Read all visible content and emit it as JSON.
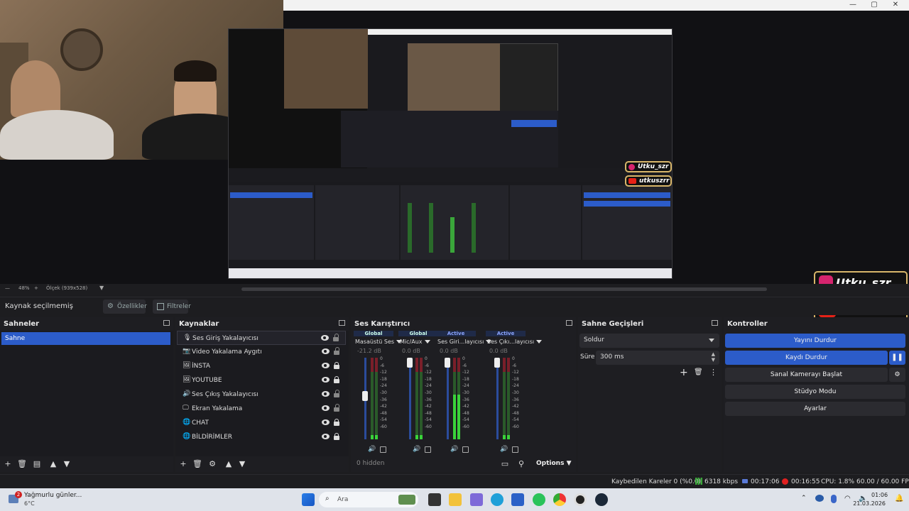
{
  "window": {
    "minimize": "—",
    "maximize": "▢",
    "close": "✕"
  },
  "zoom": {
    "percent": "48%",
    "scale": "Ölçek (939x528)"
  },
  "source_toolbar": {
    "no_source": "Kaynak seçilmemiş",
    "properties": "Özellikler",
    "filters": "Filtreler"
  },
  "scenes": {
    "title": "Sahneler",
    "items": [
      {
        "label": "Sahne",
        "selected": true
      }
    ]
  },
  "sources": {
    "title": "Kaynaklar",
    "items": [
      {
        "label": "Ses Giriş Yakalayıcısı",
        "icon": "microphone-icon",
        "glyph": "🎙",
        "locked": false,
        "selected": true
      },
      {
        "label": "Video Yakalama Aygıtı",
        "icon": "camera-icon",
        "glyph": "📷",
        "locked": false,
        "selected": false
      },
      {
        "label": "İNSTA",
        "icon": "image-icon",
        "glyph": "🖼",
        "locked": true,
        "selected": false
      },
      {
        "label": "YOUTUBE",
        "icon": "image-icon",
        "glyph": "🖼",
        "locked": true,
        "selected": false
      },
      {
        "label": "Ses Çıkış Yakalayıcısı",
        "icon": "speaker-icon",
        "glyph": "🔊",
        "locked": false,
        "selected": false
      },
      {
        "label": "Ekran Yakalama",
        "icon": "monitor-icon",
        "glyph": "🖵",
        "locked": false,
        "selected": false
      },
      {
        "label": "CHAT",
        "icon": "browser-icon",
        "glyph": "🌐",
        "locked": true,
        "selected": false
      },
      {
        "label": "BİLDİRİMLER",
        "icon": "browser-icon",
        "glyph": "🌐",
        "locked": true,
        "selected": false
      }
    ]
  },
  "mixer": {
    "title": "Ses Karıştırıcı",
    "hidden_label": "0 hidden",
    "options_label": "Options",
    "ticks": [
      "0",
      "-6",
      "-12",
      "-18",
      "-24",
      "-30",
      "-36",
      "-42",
      "-48",
      "-54",
      "-60"
    ],
    "channels": [
      {
        "tag": "Global",
        "name": "Masaüstü Ses",
        "db": "-21.2 dB",
        "level": 0.55,
        "meter_level": 0.05
      },
      {
        "tag": "Global",
        "name": "Mic/Aux",
        "db": "0.0 dB",
        "level": 1.0,
        "meter_level": 0.05
      },
      {
        "tag": "Active",
        "name": "Ses Giri...layıcısı",
        "db": "0.0 dB",
        "level": 1.0,
        "meter_level": 0.55
      },
      {
        "tag": "Active",
        "name": "Ses Çıkı...layıcısı",
        "db": "0.0 dB",
        "level": 1.0,
        "meter_level": 0.05
      }
    ]
  },
  "transitions": {
    "title": "Sahne Geçişleri",
    "selected": "Soldur",
    "duration_label": "Süre",
    "duration_value": "300 ms"
  },
  "controls": {
    "title": "Kontroller",
    "stop_stream": "Yayını Durdur",
    "stop_recording": "Kaydı Durdur",
    "virtual_cam": "Sanal Kamerayı Başlat",
    "studio_mode": "Stüdyo Modu",
    "settings": "Ayarlar"
  },
  "status": {
    "dropped": "Kaybedilen Kareler 0 (%0.0)",
    "bitrate": "6318 kbps",
    "stream_time": "00:17:06",
    "rec_time": "00:16:55",
    "cpu": "CPU: 1.8%",
    "fps": "60.00 / 60.00 FPS"
  },
  "overlays": {
    "instagram": "Utku_szr",
    "youtube": "utkuszrr"
  },
  "taskbar": {
    "weather_title": "Yağmurlu günler...",
    "weather_temp": "6°C",
    "notification_count": "2",
    "search_placeholder": "Ara",
    "time": "01:06",
    "date": "21.03.2026"
  },
  "colors": {
    "accent": "#2c5cc9",
    "dock_bg": "#1e1e22",
    "badge_border": "#d8b66a"
  }
}
